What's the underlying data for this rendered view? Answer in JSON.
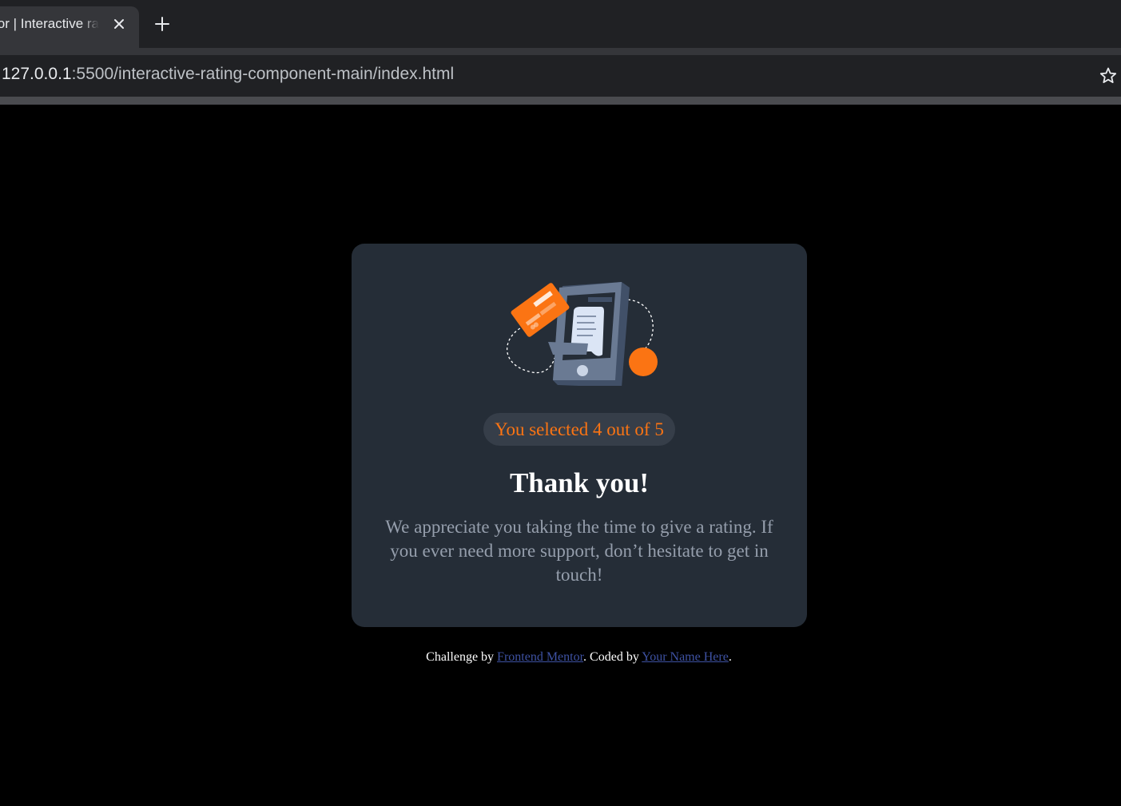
{
  "browser": {
    "tab_title": "Frontend Mentor | Interactive rating component",
    "tab_title_visible": "or | Interactive ra",
    "url_host": "127.0.0.1",
    "url_path": ":5500/interactive-rating-component-main/index.html",
    "icons": {
      "tab_close": "close-icon",
      "new_tab": "plus-icon",
      "bookmark": "star-outline-icon"
    }
  },
  "card": {
    "illustration": "phone-payment-illustration",
    "selected_text": "You selected 4 out of 5",
    "selected_rating": 4,
    "max_rating": 5,
    "heading": "Thank you!",
    "message": "We appreciate you taking the time to give a rating. If you ever need more support, don’t hesitate to get in touch!"
  },
  "footer": {
    "prefix": "Challenge by ",
    "link1": "Frontend Mentor",
    "middle": ". Coded by ",
    "link2": "Your Name Here",
    "suffix": "."
  },
  "colors": {
    "page_background": "#000000",
    "card_background": "#252d37",
    "accent_orange": "#fb7413",
    "badge_background": "#363e49",
    "body_text": "#959eac",
    "link": "#3e52a3"
  }
}
